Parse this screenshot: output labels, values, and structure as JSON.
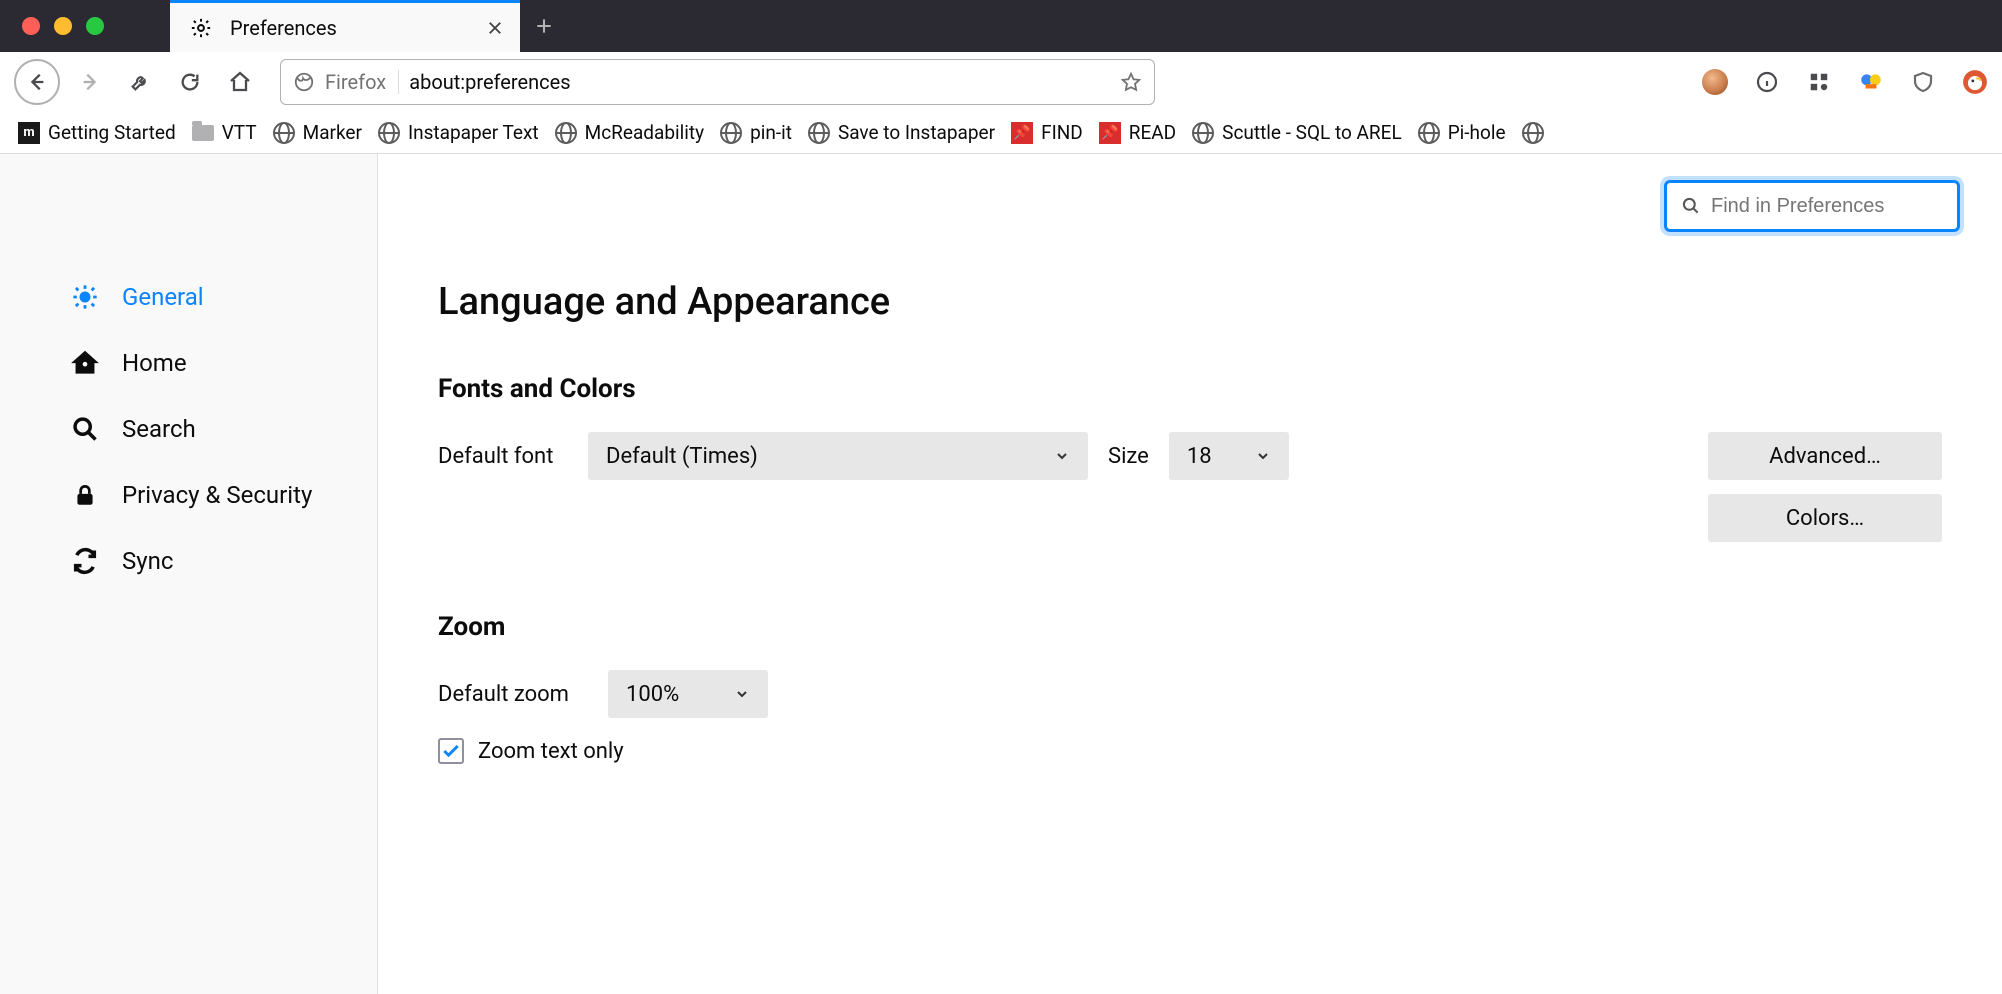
{
  "tab": {
    "title": "Preferences"
  },
  "urlbar": {
    "context": "Firefox",
    "url": "about:preferences"
  },
  "bookmarks": [
    {
      "label": "Getting Started",
      "icon": "dark-m"
    },
    {
      "label": "VTT",
      "icon": "folder"
    },
    {
      "label": "Marker",
      "icon": "globe"
    },
    {
      "label": "Instapaper Text",
      "icon": "globe"
    },
    {
      "label": "McReadability",
      "icon": "globe"
    },
    {
      "label": "pin-it",
      "icon": "globe"
    },
    {
      "label": "Save to Instapaper",
      "icon": "globe"
    },
    {
      "label": "FIND",
      "icon": "red-pin"
    },
    {
      "label": "READ",
      "icon": "red-pin"
    },
    {
      "label": "Scuttle - SQL to AREL",
      "icon": "globe"
    },
    {
      "label": "Pi-hole",
      "icon": "globe"
    }
  ],
  "sidebar": {
    "items": [
      {
        "label": "General",
        "icon": "gear",
        "active": true
      },
      {
        "label": "Home",
        "icon": "home",
        "active": false
      },
      {
        "label": "Search",
        "icon": "search",
        "active": false
      },
      {
        "label": "Privacy & Security",
        "icon": "lock",
        "active": false
      },
      {
        "label": "Sync",
        "icon": "sync",
        "active": false
      }
    ]
  },
  "search": {
    "placeholder": "Find in Preferences"
  },
  "content": {
    "section_title": "Language and Appearance",
    "fonts": {
      "heading": "Fonts and Colors",
      "default_font_label": "Default font",
      "default_font_value": "Default (Times)",
      "size_label": "Size",
      "size_value": "18",
      "advanced_btn": "Advanced…",
      "colors_btn": "Colors…"
    },
    "zoom": {
      "heading": "Zoom",
      "default_zoom_label": "Default zoom",
      "default_zoom_value": "100%",
      "text_only_label": "Zoom text only",
      "text_only_checked": true
    }
  }
}
